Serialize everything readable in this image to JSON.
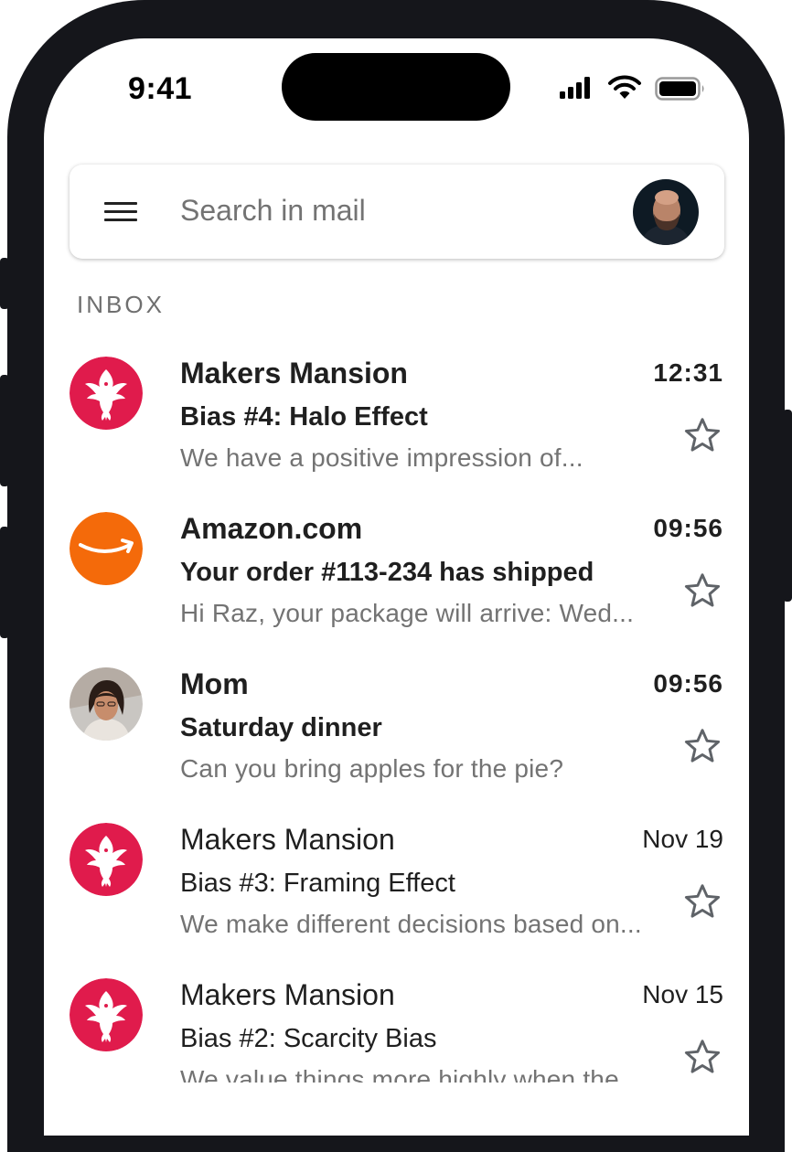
{
  "status_bar": {
    "time": "9:41",
    "icons": [
      "cellular-signal-icon",
      "wifi-icon",
      "battery-icon"
    ]
  },
  "search": {
    "placeholder": "Search in mail",
    "menu_icon": "hamburger-menu-icon",
    "account_avatar": "user-avatar"
  },
  "inbox": {
    "label": "INBOX",
    "emails": [
      {
        "sender": "Makers Mansion",
        "time": "12:31",
        "subject": "Bias #4: Halo Effect",
        "snippet": "We have a positive impression of...",
        "unread": true,
        "starred": false,
        "avatar": "phoenix-logo"
      },
      {
        "sender": "Amazon.com",
        "time": "09:56",
        "subject": "Your order #113-234 has shipped",
        "snippet": "Hi Raz, your package will arrive: Wed...",
        "unread": true,
        "starred": false,
        "avatar": "amazon-logo"
      },
      {
        "sender": "Mom",
        "time": "09:56",
        "subject": "Saturday dinner",
        "snippet": "Can you bring apples for the pie?",
        "unread": true,
        "starred": false,
        "avatar": "contact-photo"
      },
      {
        "sender": "Makers Mansion",
        "time": "Nov 19",
        "subject": "Bias #3: Framing Effect",
        "snippet": "We make different decisions based on...",
        "unread": false,
        "starred": false,
        "avatar": "phoenix-logo"
      },
      {
        "sender": "Makers Mansion",
        "time": "Nov 15",
        "subject": "Bias #2: Scarcity Bias",
        "snippet": "We value things more highly when the...",
        "unread": false,
        "starred": false,
        "avatar": "phoenix-logo"
      }
    ]
  },
  "colors": {
    "makers_mansion": "#e01b4c",
    "amazon": "#f46a0a",
    "star_outline": "#5f6368",
    "snippet_text": "#737373"
  }
}
